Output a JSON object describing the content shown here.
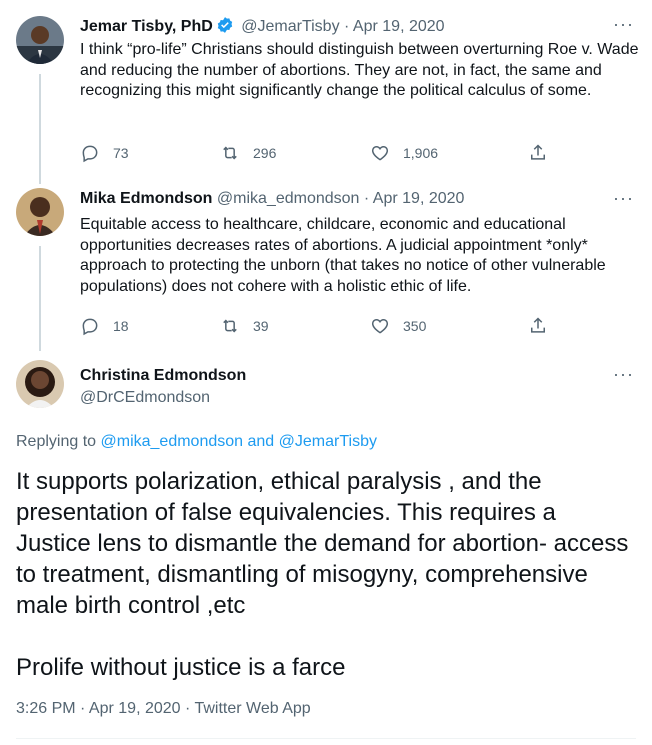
{
  "tweets": [
    {
      "author_name": "Jemar Tisby, PhD",
      "verified": true,
      "handle": "@JemarTisby",
      "date": "Apr 19, 2020",
      "text": "I think “pro-life” Christians should distinguish between overturning Roe v. Wade and reducing the number of abortions. They are not, in fact, the same and recognizing this might significantly change the political calculus of some.",
      "replies": "73",
      "retweets": "296",
      "likes": "1,906"
    },
    {
      "author_name": "Mika Edmondson",
      "verified": false,
      "handle": "@mika_edmondson",
      "date": "Apr 19, 2020",
      "text": "Equitable access to healthcare, childcare, economic and educational opportunities decreases rates of abortions. A judicial appointment *only* approach to protecting the unborn (that takes no notice of other vulnerable populations) does not cohere with a holistic ethic of life.",
      "replies": "18",
      "retweets": "39",
      "likes": "350"
    }
  ],
  "main_tweet": {
    "author_name": "Christina Edmondson",
    "handle": "@DrCEdmondson",
    "replying_prefix": "Replying to",
    "replying_user1": "@mika_edmondson",
    "replying_and": "and",
    "replying_user2": "@JemarTisby",
    "paragraph1": "It supports polarization, ethical paralysis , and the presentation of false equivalencies. This requires a Justice lens to dismantle the demand for abortion- access to treatment, dismantling of misogyny, comprehensive male birth control ,etc",
    "paragraph2": "Prolife without justice is a farce",
    "timestamp": "3:26 PM · Apr 19, 2020 · Twitter Web App"
  },
  "separator": "·",
  "more_label": "···",
  "colors": {
    "link": "#1d9bf0",
    "muted": "#536471",
    "text": "#0f1419",
    "thread_line": "#cfd9de"
  },
  "icons": [
    "reply-icon",
    "retweet-icon",
    "like-icon",
    "share-icon",
    "verified-badge-icon",
    "more-icon"
  ]
}
